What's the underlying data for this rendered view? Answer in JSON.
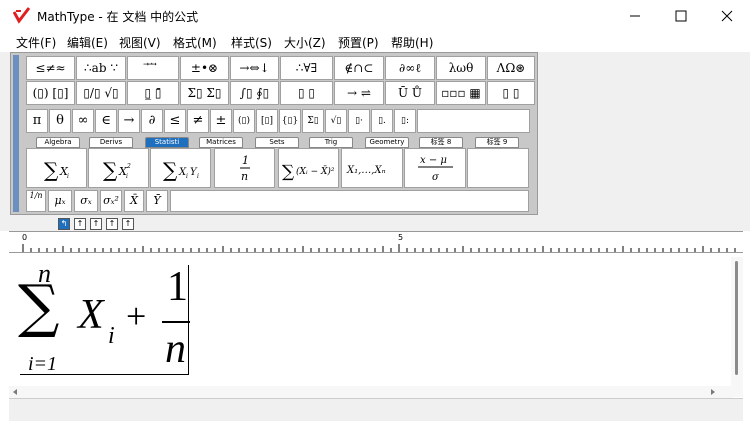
{
  "window": {
    "title": "MathType - 在 文档 中的公式",
    "controls": [
      "minimize",
      "maximize",
      "close"
    ]
  },
  "menu": [
    "文件(F)",
    "编辑(E)",
    "视图(V)",
    "格式(M)",
    "样式(S)",
    "大小(Z)",
    "预置(P)",
    "帮助(H)"
  ],
  "palette_row1": [
    "≤≠≈",
    "∴ab ∵",
    "⃗ ⃑ ⃗",
    "±•⊗",
    "→⇔↓",
    "∴∀∃",
    "∉∩⊂",
    "∂∞ℓ",
    "λωθ",
    "ΛΩ⊛"
  ],
  "palette_row2": [
    "(▯) [▯]",
    "▯/▯ √▯",
    "▯̲ ▯̄",
    "Σ▯ Σ▯",
    "∫▯ ∮▯",
    "▯ ▯",
    "→ ⇌",
    "Ū Ů",
    "▫▫▫ ▦",
    "▯ ▯"
  ],
  "symbol_row": [
    "π",
    "θ",
    "∞",
    "∈",
    "→",
    "∂",
    "≤",
    "≠",
    "±",
    "(▯)",
    "[▯]",
    "{▯}",
    "Σ▯",
    "√▯",
    "▯·",
    "▯.",
    "▯:"
  ],
  "tabs": [
    "Algebra",
    "Derivs",
    "Statisti",
    "Matrices",
    "Sets",
    "Trig",
    "Geometry",
    "标签 8",
    "标签 9"
  ],
  "active_tab": "Statisti",
  "templates": [
    "ΣXᵢ",
    "ΣXᵢ²",
    "ΣXᵢYᵢ",
    "1/n",
    "Σ(Xᵢ−X̄)²",
    "X₁,…,Xₙ",
    "(x−μ)/σ"
  ],
  "small_templates": [
    "1/n",
    "μₓ",
    "σₓ",
    "σₓ²",
    "X̄",
    "Ȳ"
  ],
  "nav_buttons": [
    "↰",
    "↑",
    "↑",
    "↑",
    "↑"
  ],
  "ruler": {
    "marks": [
      "0",
      "5"
    ]
  },
  "equation": {
    "sum_upper": "n",
    "sum_symbol": "∑",
    "sum_lower": "i=1",
    "variable": "X",
    "subscript": "i",
    "operator": "+",
    "numerator": "1",
    "denominator": "n"
  },
  "colors": {
    "accent": "#1f6fbf",
    "logo": "#e02020"
  }
}
